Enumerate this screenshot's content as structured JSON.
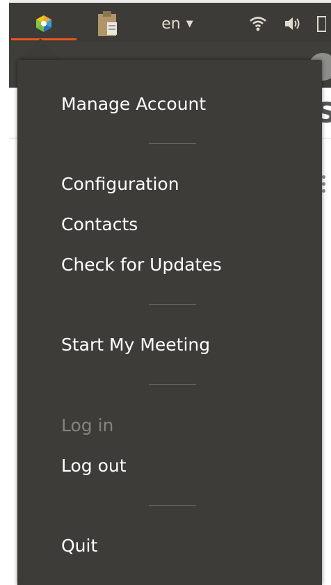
{
  "panel": {
    "app_icon": "ubuntu-one-meeting-icon",
    "clipboard_icon": "clipboard-icon",
    "language": "en",
    "language_caret_icon": "caret-down-icon",
    "network_icon": "wifi-icon",
    "sound_icon": "speaker-volume-icon",
    "accent_color": "#e95420"
  },
  "menu": {
    "items": [
      {
        "label": "Manage Account",
        "enabled": true
      },
      {
        "label": "Configuration",
        "enabled": true
      },
      {
        "label": "Contacts",
        "enabled": true
      },
      {
        "label": "Check for Updates",
        "enabled": true
      },
      {
        "label": "Start My Meeting",
        "enabled": true
      },
      {
        "label": "Log in",
        "enabled": false
      },
      {
        "label": "Log out",
        "enabled": true
      },
      {
        "label": "Quit",
        "enabled": true
      }
    ],
    "background_color": "#3d3c38",
    "disabled_text_color": "#85837e"
  }
}
